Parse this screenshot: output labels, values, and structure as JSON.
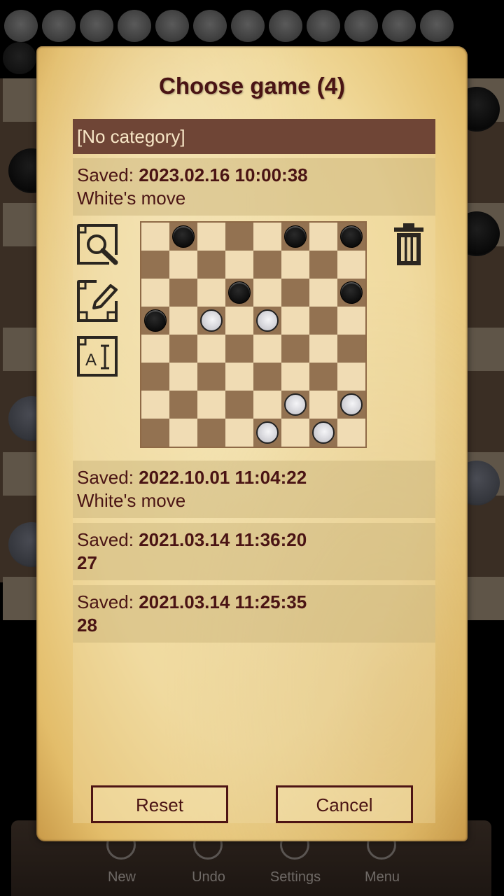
{
  "dialog": {
    "title": "Choose game (4)",
    "category": "[No category]",
    "saved_label": "Saved:",
    "entries": [
      {
        "date": "2023.02.16 10:00:38",
        "subtitle": "White's move",
        "subtitle_bold": false,
        "expanded": true
      },
      {
        "date": "2022.10.01 11:04:22",
        "subtitle": "White's move",
        "subtitle_bold": false
      },
      {
        "date": "2021.03.14 11:36:20",
        "subtitle": "27",
        "subtitle_bold": true
      },
      {
        "date": "2021.03.14 11:25:35",
        "subtitle": "28",
        "subtitle_bold": true
      }
    ],
    "actions": [
      {
        "name": "preview-icon"
      },
      {
        "name": "edit-icon"
      },
      {
        "name": "rename-icon"
      }
    ],
    "delete_icon": "trash-icon",
    "buttons": {
      "reset": "Reset",
      "cancel": "Cancel"
    }
  },
  "preview_board": {
    "size": 8,
    "black": [
      [
        0,
        1
      ],
      [
        0,
        5
      ],
      [
        0,
        7
      ],
      [
        2,
        3
      ],
      [
        2,
        7
      ],
      [
        3,
        0
      ]
    ],
    "white": [
      [
        3,
        2
      ],
      [
        3,
        4
      ],
      [
        6,
        5
      ],
      [
        6,
        7
      ],
      [
        7,
        4
      ],
      [
        7,
        6
      ]
    ]
  },
  "toolbar": {
    "items": [
      {
        "label": "New",
        "icon": "new-game-icon"
      },
      {
        "label": "Undo",
        "icon": "undo-icon"
      },
      {
        "label": "Settings",
        "icon": "settings-icon"
      },
      {
        "label": "Menu",
        "icon": "menu-icon"
      }
    ]
  }
}
